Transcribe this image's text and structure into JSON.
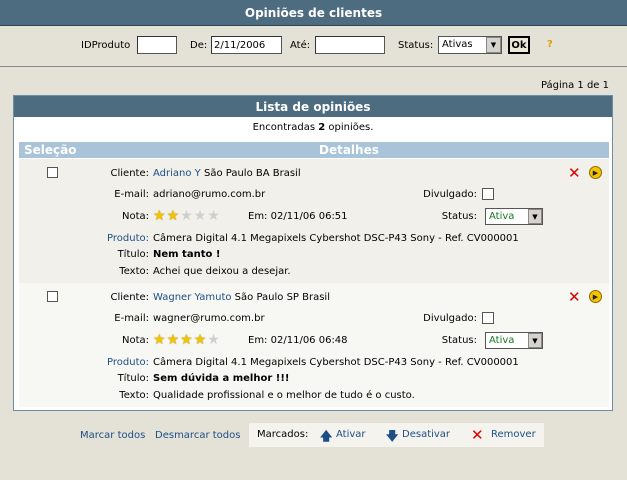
{
  "header": {
    "title": "Opiniões de clientes"
  },
  "filter": {
    "idproduto_label": "IDProduto",
    "idproduto_value": "",
    "de_label": "De:",
    "de_value": "2/11/2006",
    "ate_label": "Até:",
    "ate_value": "",
    "status_label": "Status:",
    "status_value": "Ativas",
    "ok_label": "Ok",
    "help_symbol": "?"
  },
  "pagination": {
    "text": "Página 1 de 1"
  },
  "list": {
    "title": "Lista de opiniões",
    "found_prefix": "Encontradas ",
    "found_count": "2",
    "found_suffix": " opiniões.",
    "col_selection": "Seleção",
    "col_details": "Detalhes"
  },
  "labels": {
    "cliente": "Cliente:",
    "email": "E-mail:",
    "nota": "Nota:",
    "em_prefix": "Em:",
    "produto": "Produto:",
    "titulo": "Título:",
    "texto": "Texto:",
    "divulgado": "Divulgado:",
    "status": "Status:"
  },
  "reviews": [
    {
      "client_name": "Adriano Y",
      "client_location": "São Paulo BA Brasil",
      "email": "adriano@rumo.com.br",
      "rating": 2,
      "rating_max": 5,
      "date": "02/11/06 06:51",
      "status": "Ativa",
      "product": "Câmera Digital 4.1 Megapixels Cybershot DSC-P43 Sony - Ref. CV000001",
      "title": "Nem tanto !",
      "text": "Achei que deixou a desejar."
    },
    {
      "client_name": "Wagner Yamuto",
      "client_location": "São Paulo SP Brasil",
      "email": "wagner@rumo.com.br",
      "rating": 4,
      "rating_max": 5,
      "date": "02/11/06 06:48",
      "status": "Ativa",
      "product": "Câmera Digital 4.1 Megapixels Cybershot DSC-P43 Sony - Ref. CV000001",
      "title": "Sem dúvida a melhor !!!",
      "text": "Qualidade profissional e o melhor de tudo é o custo."
    }
  ],
  "footer": {
    "select_all": "Marcar todos",
    "deselect_all": "Desmarcar todos",
    "marked_label": "Marcados:",
    "activate": "Ativar",
    "deactivate": "Desativar",
    "remove": "Remover"
  },
  "colors": {
    "header_bg": "#4e6c80",
    "column_header_bg": "#a9c4d8",
    "link": "#1d4f86",
    "status_green": "#157a1f",
    "delete_red": "#d00000",
    "star_gold": "#f2c400"
  }
}
